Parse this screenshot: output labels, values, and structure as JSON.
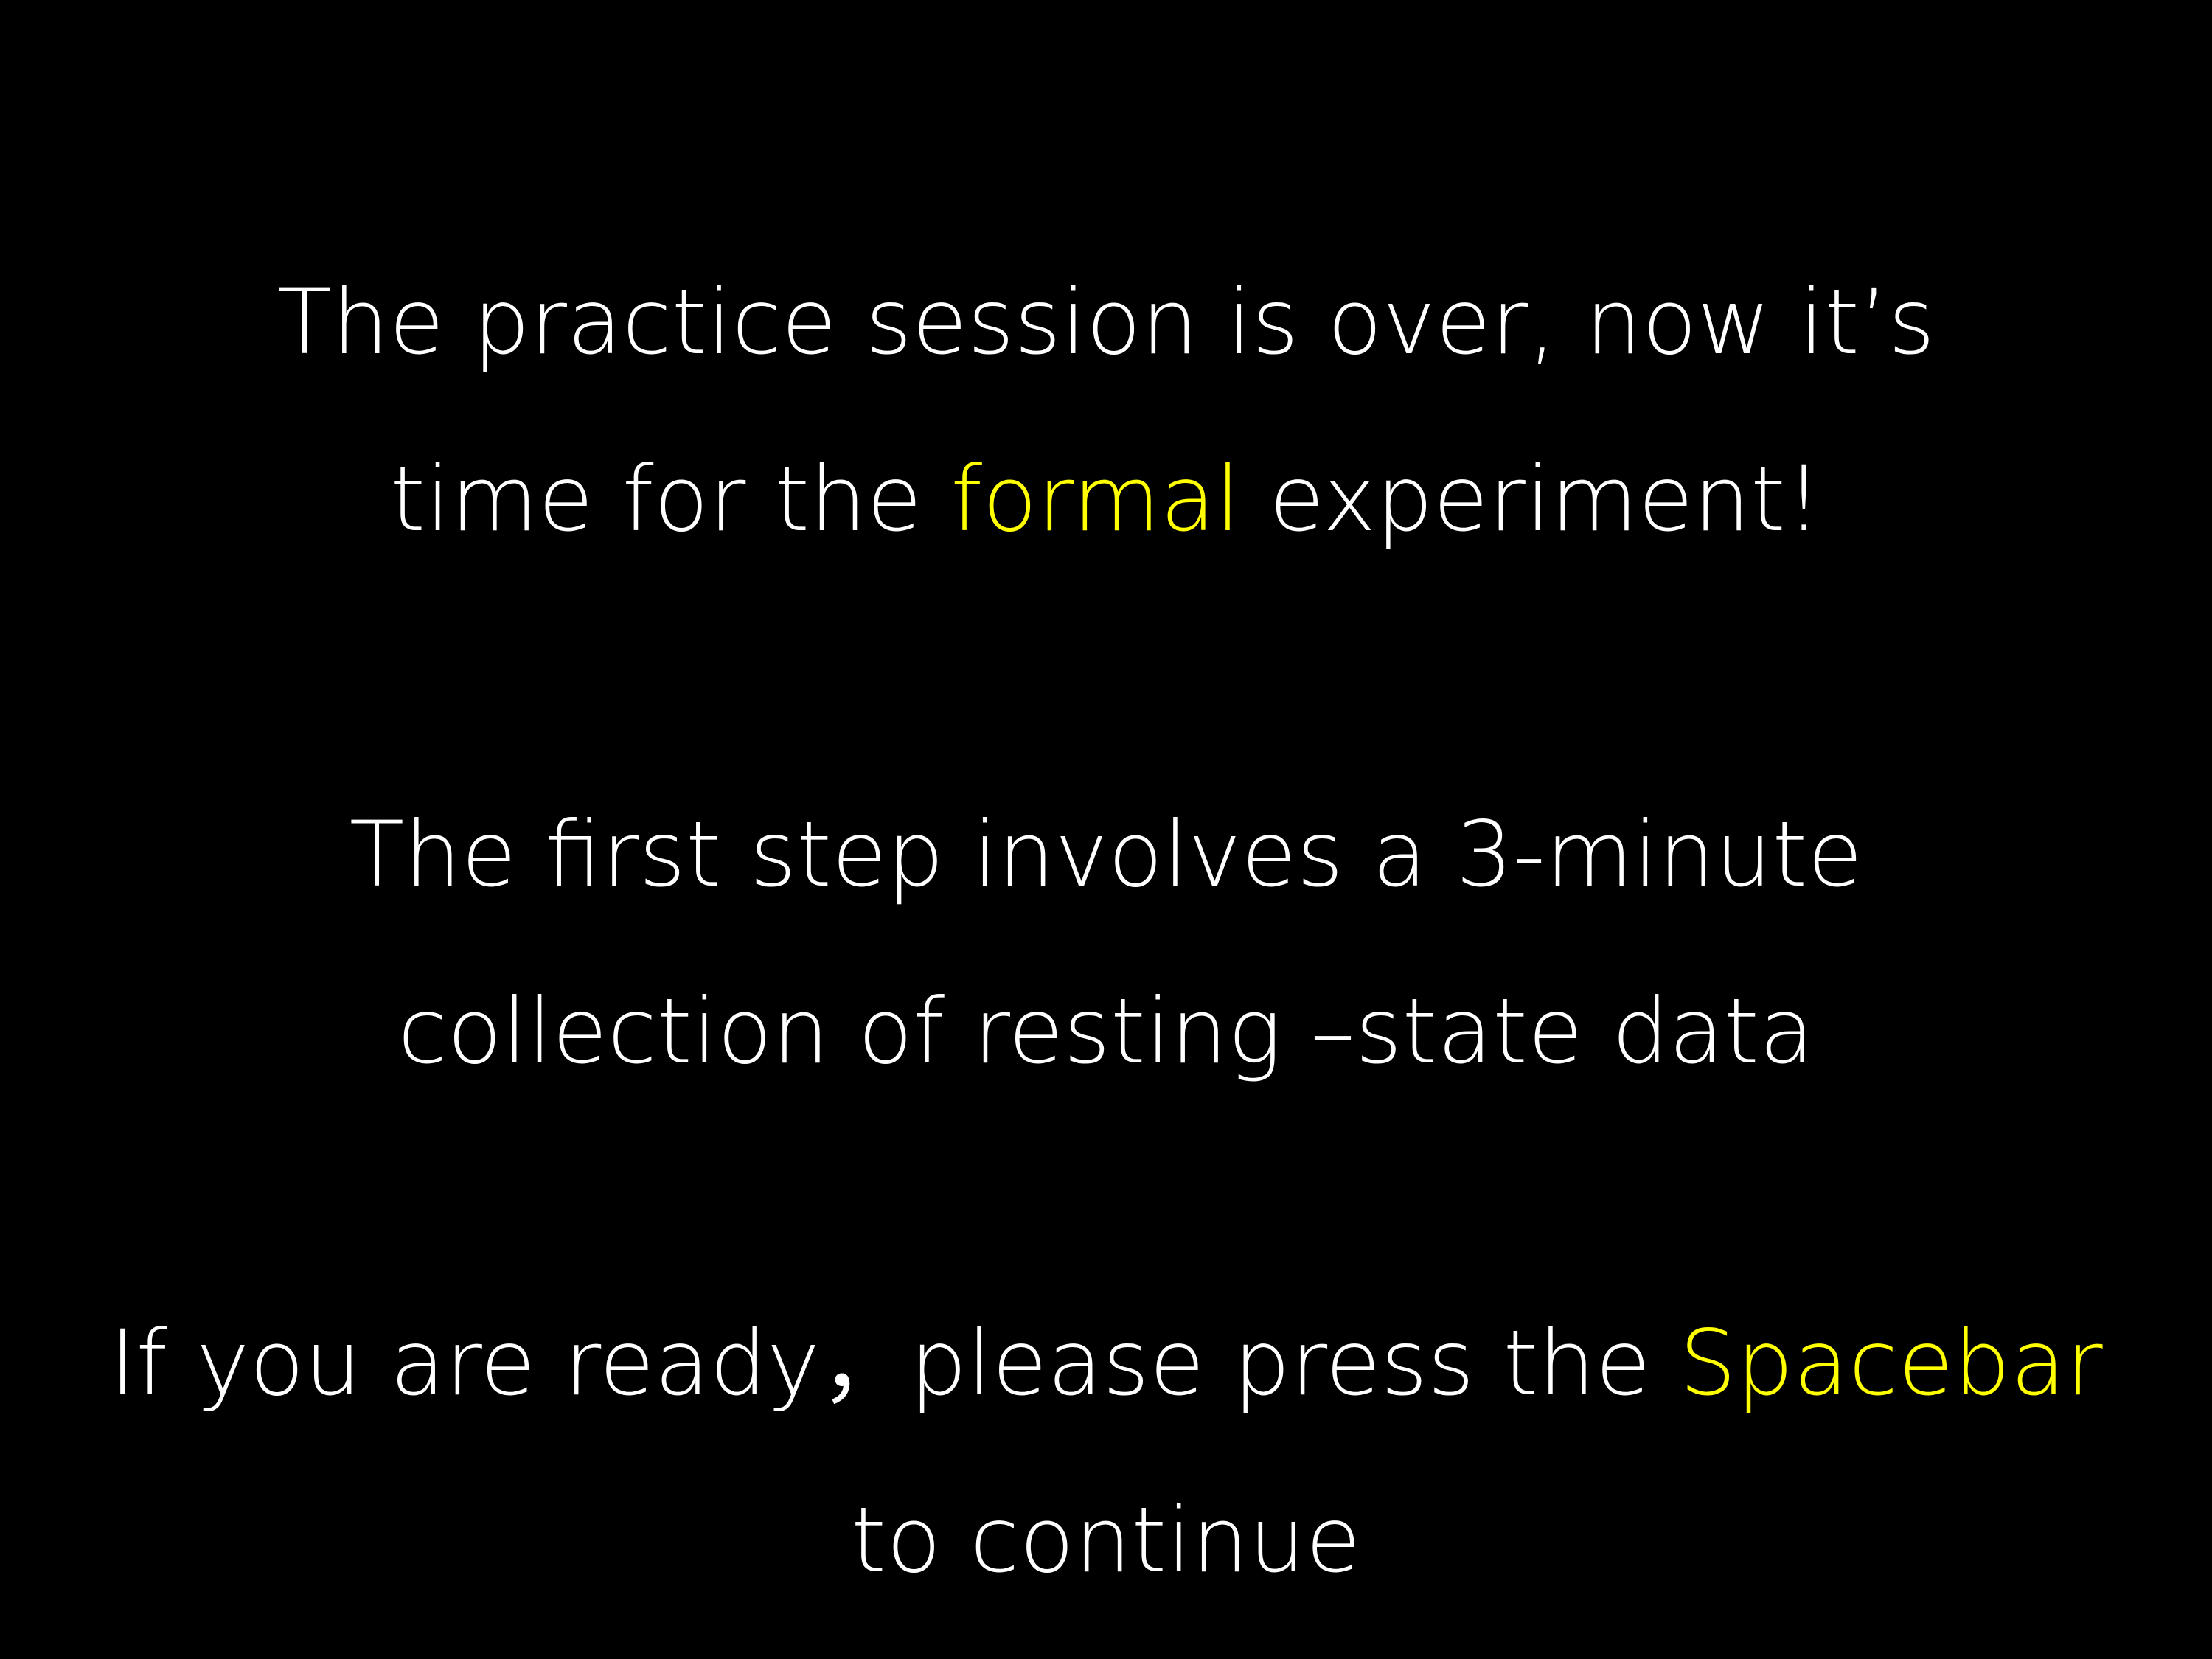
{
  "accent_color": "#ffff00",
  "text_color": "#ffffff",
  "background_color": "#000000",
  "paragraph1": {
    "line1": "The practice session is over, now it’s",
    "line2_before": "time for the ",
    "line2_highlight": "formal",
    "line2_after": " experiment!"
  },
  "paragraph2": {
    "line1": "The first step involves a 3-minute",
    "line2": "collection of resting –state data"
  },
  "paragraph3": {
    "line1_before": "If you are ready，please press the ",
    "line1_highlight": "Spacebar",
    "line2": "to continue"
  }
}
